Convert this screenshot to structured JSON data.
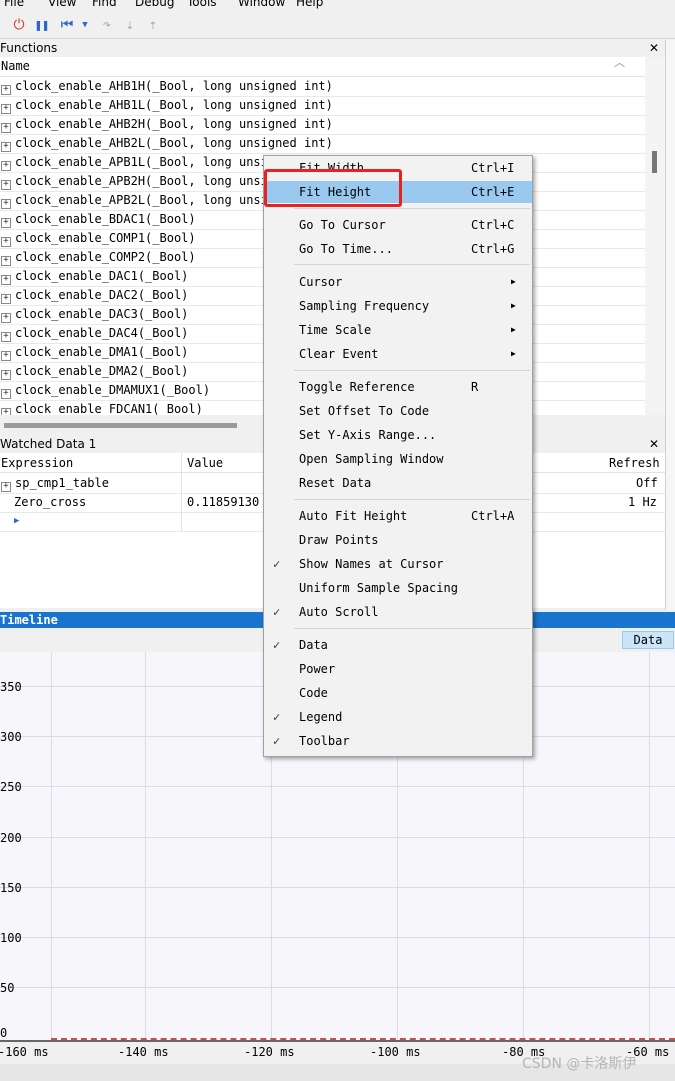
{
  "menubar": [
    "File",
    "View",
    "Find",
    "Debug",
    "Tools",
    "Window",
    "Help"
  ],
  "functions": {
    "title": "Functions",
    "column_name": "Name",
    "rows": [
      "clock_enable_AHB1H(_Bool, long unsigned int)",
      "clock_enable_AHB1L(_Bool, long unsigned int)",
      "clock_enable_AHB2H(_Bool, long unsigned int)",
      "clock_enable_AHB2L(_Bool, long unsigned int)",
      "clock_enable_APB1L(_Bool, long unsig",
      "clock_enable_APB2H(_Bool, long unsig",
      "clock_enable_APB2L(_Bool, long unsig",
      "clock_enable_BDAC1(_Bool)",
      "clock_enable_COMP1(_Bool)",
      "clock_enable_COMP2(_Bool)",
      "clock_enable_DAC1(_Bool)",
      "clock_enable_DAC2(_Bool)",
      "clock_enable_DAC3(_Bool)",
      "clock_enable_DAC4(_Bool)",
      "clock_enable_DMA1(_Bool)",
      "clock_enable_DMA2(_Bool)",
      "clock_enable_DMAMUX1(_Bool)",
      "clock_enable_FDCAN1(_Bool)"
    ]
  },
  "watched": {
    "title": "Watched Data 1",
    "col_expression": "Expression",
    "col_value": "Value",
    "col_refresh": "Refresh",
    "rows": [
      {
        "expression": "sp_cmp1_table",
        "value": "",
        "refresh": "Off"
      },
      {
        "expression": "Zero_cross",
        "value": "0.11859130",
        "refresh": "1 Hz"
      }
    ]
  },
  "timeline": {
    "title": "Timeline",
    "data_button": "Data",
    "y_ticks": [
      "350",
      "300",
      "250",
      "200",
      "150",
      "100",
      "50",
      "0"
    ],
    "x_ticks": [
      "-160 ms",
      "-140 ms",
      "-120 ms",
      "-100 ms",
      "-80 ms",
      "-60 ms"
    ]
  },
  "context_menu": {
    "items": [
      {
        "label": "Fit Width",
        "shortcut": "Ctrl+I"
      },
      {
        "label": "Fit Height",
        "shortcut": "Ctrl+E",
        "highlighted": true
      },
      {
        "label": "Go To Cursor",
        "shortcut": "Ctrl+C"
      },
      {
        "label": "Go To Time...",
        "shortcut": "Ctrl+G"
      },
      {
        "label": "Cursor",
        "submenu": true
      },
      {
        "label": "Sampling Frequency",
        "submenu": true
      },
      {
        "label": "Time Scale",
        "submenu": true
      },
      {
        "label": "Clear Event",
        "submenu": true
      },
      {
        "label": "Toggle Reference",
        "shortcut": "R"
      },
      {
        "label": "Set Offset To Code"
      },
      {
        "label": "Set Y-Axis Range..."
      },
      {
        "label": "Open Sampling Window"
      },
      {
        "label": "Reset Data"
      },
      {
        "label": "Auto Fit Height",
        "shortcut": "Ctrl+A"
      },
      {
        "label": "Draw Points"
      },
      {
        "label": "Show Names at Cursor",
        "checked": true
      },
      {
        "label": "Uniform Sample Spacing"
      },
      {
        "label": "Auto Scroll",
        "checked": true
      },
      {
        "label": "Data",
        "checked": true
      },
      {
        "label": "Power"
      },
      {
        "label": "Code"
      },
      {
        "label": "Legend",
        "checked": true
      },
      {
        "label": "Toolbar",
        "checked": true
      }
    ]
  },
  "watermark": "CSDN @卡洛斯伊",
  "colors": {
    "highlight": "#99c9ef",
    "timeline_header": "#1874cd",
    "callout": "#e8231f"
  }
}
